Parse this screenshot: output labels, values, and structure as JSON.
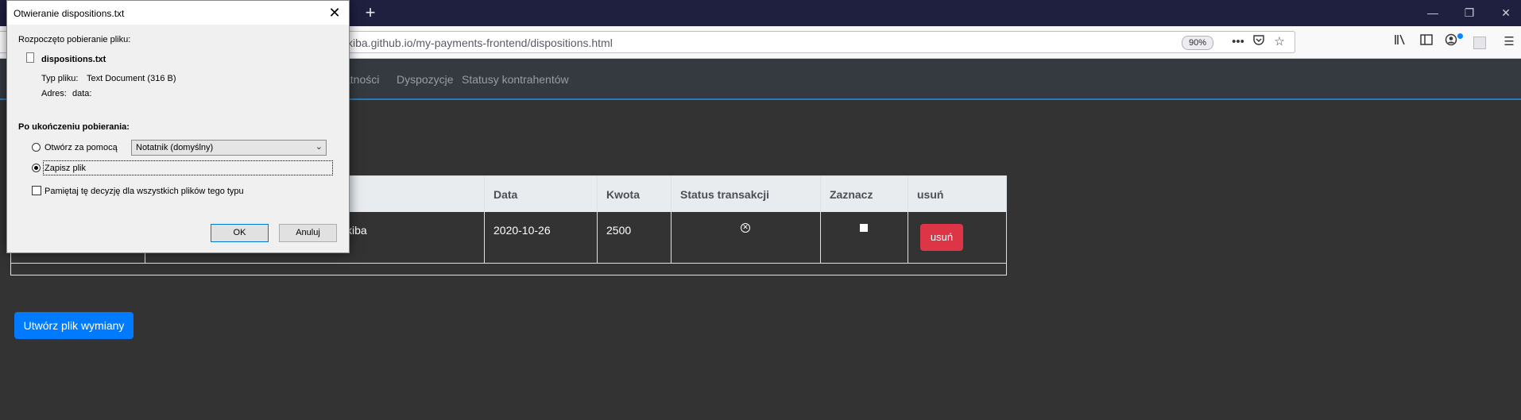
{
  "browser": {
    "url": "kiba.github.io/my-payments-frontend/dispositions.html",
    "zoom": "90%",
    "new_tab_icon": "+",
    "minimize_icon": "—",
    "restore_icon": "❐",
    "close_icon": "✕"
  },
  "site_nav": {
    "items": [
      "atności",
      "Dyspozycje",
      "Statusy kontrahentów"
    ]
  },
  "table": {
    "headers": [
      "Data",
      "Kwota",
      "Status transakcji",
      "Zaznacz",
      "usuń"
    ],
    "rows": [
      {
        "name_fragment": "kiba",
        "date": "2020-10-26",
        "amount": "2500",
        "delete_label": "usuń"
      }
    ]
  },
  "create_button": "Utwórz plik wymiany",
  "dialog": {
    "title": "Otwieranie dispositions.txt",
    "intro": "Rozpoczęto pobieranie pliku:",
    "file_name": "dispositions.txt",
    "type_label": "Typ pliku:",
    "type_value": "Text Document (316 B)",
    "address_label": "Adres:",
    "address_value": "data:",
    "after_download": "Po ukończeniu pobierania:",
    "open_with_label": "Otwórz za pomocą",
    "open_with_app": "Notatnik (domyślny)",
    "save_label": "Zapisz plik",
    "remember_label": "Pamiętaj tę decyzję dla wszystkich plików tego typu",
    "ok": "OK",
    "cancel": "Anuluj",
    "selected_option": "save"
  },
  "colors": {
    "page_bg": "#333333",
    "titlebar": "#1f1f3f",
    "delete_button": "#dc3545",
    "primary_button": "#007bff"
  }
}
